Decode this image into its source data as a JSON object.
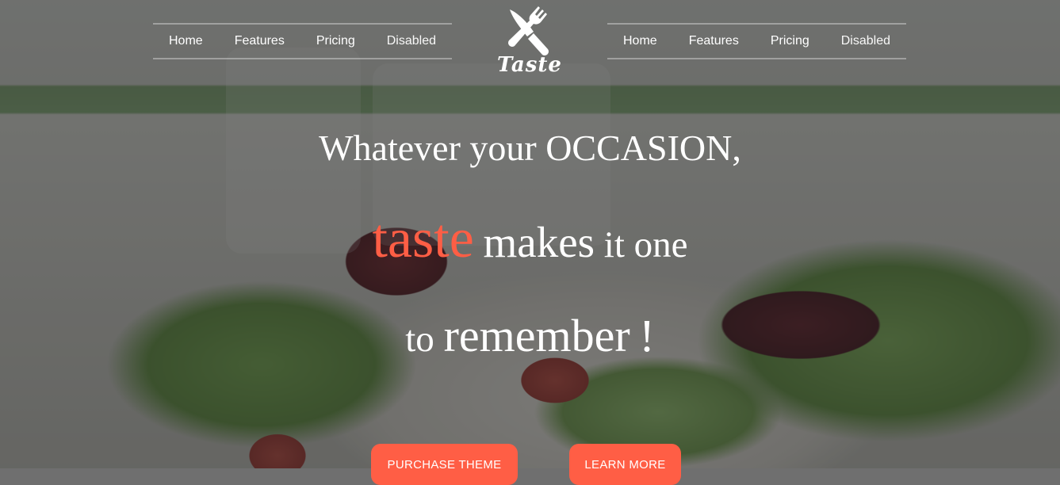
{
  "nav_left": {
    "items": [
      {
        "label": "Home"
      },
      {
        "label": "Features"
      },
      {
        "label": "Pricing"
      },
      {
        "label": "Disabled"
      }
    ]
  },
  "nav_right": {
    "items": [
      {
        "label": "Home"
      },
      {
        "label": "Features"
      },
      {
        "label": "Pricing"
      },
      {
        "label": "Disabled"
      }
    ]
  },
  "logo": {
    "icon": "fork-knife-crossed-icon",
    "text": "Taste"
  },
  "hero": {
    "line1": "Whatever your OCCASION,",
    "line2_accent": "taste",
    "line2_big": "makes",
    "line2_rest": "it one",
    "line3_small": "to",
    "line3_big": "remember",
    "line3_excl": "!"
  },
  "buttons": {
    "purchase_label": "PURCHASE THEME",
    "learn_label": "LEARN MORE"
  },
  "colors": {
    "accent": "#ff5e45",
    "text": "#ffffff"
  }
}
